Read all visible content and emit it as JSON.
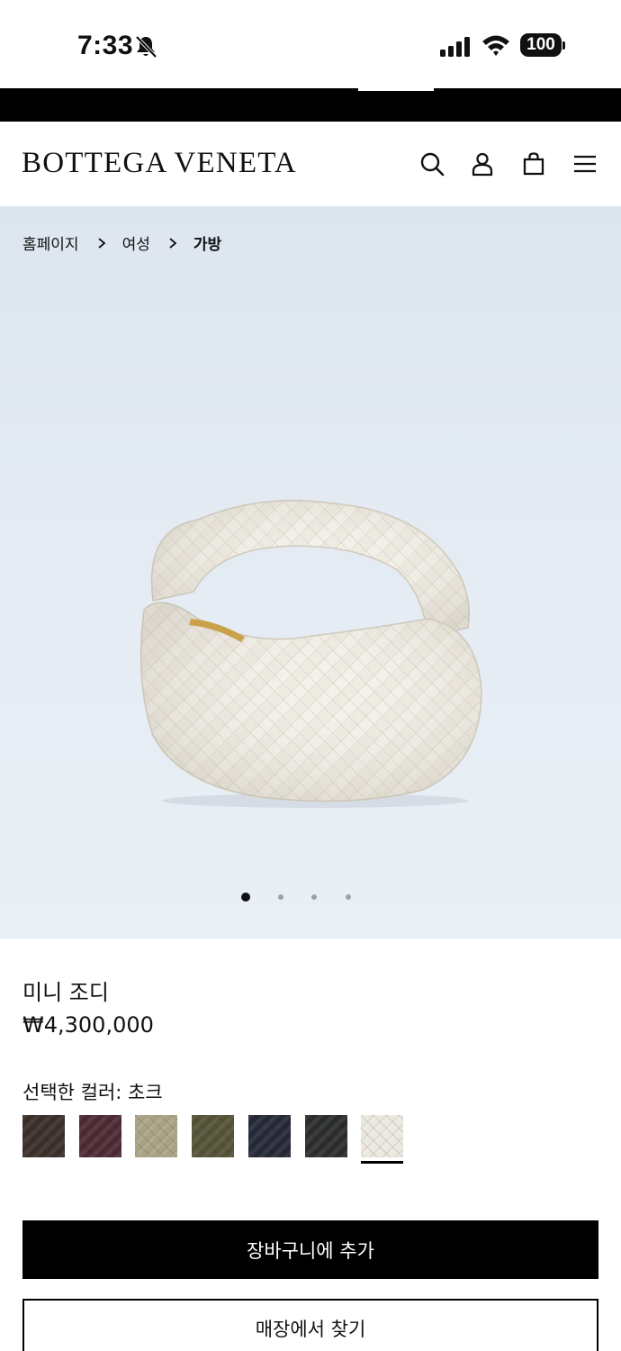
{
  "status_bar": {
    "time": "7:33",
    "battery": "100",
    "icons": [
      "bell-slash-icon",
      "signal-icon",
      "wifi-icon",
      "battery-icon"
    ]
  },
  "header": {
    "brand": "BOTTEGA VENETA",
    "icons": [
      "search-icon",
      "account-icon",
      "shopping-bag-icon",
      "menu-icon"
    ]
  },
  "breadcrumb": {
    "items": [
      "홈페이지",
      "여성",
      "가방"
    ]
  },
  "gallery": {
    "slide_count": 4,
    "active_slide": 1
  },
  "product": {
    "name": "미니 조디",
    "price": "₩4,300,000",
    "color_label": "선택한 컬러:",
    "selected_color": "초크",
    "swatches": [
      {
        "color": "#3a2f29"
      },
      {
        "color": "#4d2a33"
      },
      {
        "color": "#a9a384"
      },
      {
        "color": "#545237"
      },
      {
        "color": "#252836"
      },
      {
        "color": "#2b2c2d"
      },
      {
        "color": "#ece8df",
        "selected": true
      }
    ]
  },
  "actions": {
    "add_to_cart": "장바구니에 추가",
    "find_in_store": "매장에서 찾기"
  }
}
